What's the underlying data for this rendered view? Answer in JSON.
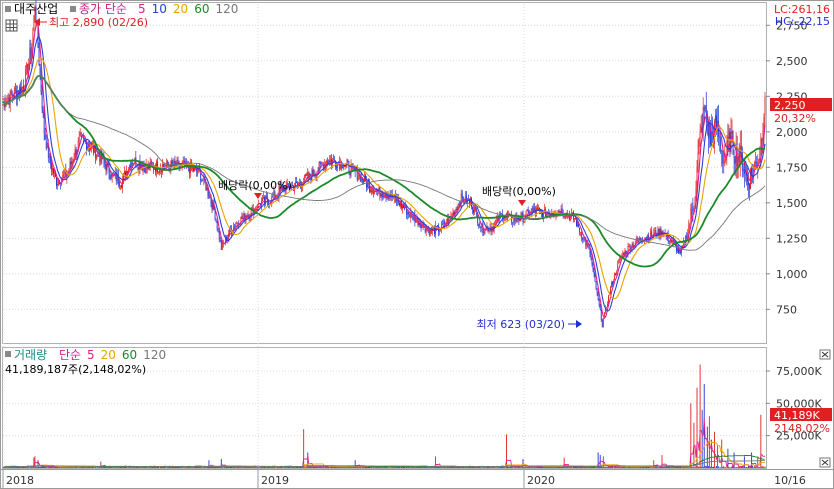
{
  "header": {
    "stock_name": "대주산업",
    "price_legend_label": "종가 단순",
    "ma_periods": [
      "5",
      "10",
      "20",
      "60",
      "120"
    ],
    "ma_colors": [
      "#e0218a",
      "#2a40d8",
      "#e8a400",
      "#1a8a2a",
      "#777777"
    ],
    "lc_text": "LC:261,16",
    "hc_text": "HC:-22,15"
  },
  "volume_header": {
    "label": "거래량",
    "legend_label": "단순",
    "ma_periods": [
      "5",
      "20",
      "60",
      "120"
    ],
    "ma_colors": [
      "#e0218a",
      "#e8a400",
      "#1a8a2a",
      "#777777"
    ],
    "value_text": "41,189,187주(2,148,02%)"
  },
  "annotations": {
    "high": "최고 2,890 (02/26)",
    "low": "최저 623 (03/20)",
    "dividend_1": "배당락(0,00%)",
    "dividend_2": "배당락(0,00%)"
  },
  "current": {
    "price_box": "2,250",
    "price_pct": "20,32%",
    "volume_box": "41,189K",
    "volume_pct": "2148,02%"
  },
  "colors": {
    "up": "#e02020",
    "down": "#2030d0",
    "grid": "#d8d8d8",
    "axis_text": "#333333",
    "current_box": "#e02020"
  },
  "chart_data": {
    "type": "candlestick",
    "price_axis": {
      "ticks": [
        "2,750",
        "2,500",
        "2,250",
        "2,000",
        "1,750",
        "1,500",
        "1,250",
        "1,000",
        "750"
      ],
      "tick_values": [
        2750,
        2500,
        2250,
        2000,
        1750,
        1500,
        1250,
        1000,
        750
      ],
      "ylim": [
        520,
        2900
      ]
    },
    "volume_axis": {
      "ticks": [
        "75,000K",
        "50,000K",
        "25,000K"
      ],
      "tick_values": [
        75000,
        50000,
        25000
      ],
      "ylim": [
        0,
        92000
      ]
    },
    "x_labels": [
      "2018",
      "2019",
      "2020",
      "10/16"
    ],
    "price_keypoints": [
      [
        0,
        2200
      ],
      [
        10,
        2270
      ],
      [
        20,
        2320
      ],
      [
        28,
        2600
      ],
      [
        31,
        2890
      ],
      [
        35,
        2500
      ],
      [
        40,
        2000
      ],
      [
        45,
        1800
      ],
      [
        52,
        1650
      ],
      [
        62,
        1700
      ],
      [
        75,
        1950
      ],
      [
        85,
        1900
      ],
      [
        95,
        1820
      ],
      [
        105,
        1700
      ],
      [
        115,
        1650
      ],
      [
        125,
        1800
      ],
      [
        140,
        1750
      ],
      [
        155,
        1760
      ],
      [
        170,
        1760
      ],
      [
        180,
        1750
      ],
      [
        190,
        1720
      ],
      [
        198,
        1600
      ],
      [
        205,
        1450
      ],
      [
        212,
        1180
      ],
      [
        220,
        1300
      ],
      [
        228,
        1370
      ],
      [
        240,
        1430
      ],
      [
        250,
        1500
      ],
      [
        260,
        1520
      ],
      [
        270,
        1600
      ],
      [
        285,
        1620
      ],
      [
        300,
        1700
      ],
      [
        315,
        1800
      ],
      [
        330,
        1780
      ],
      [
        345,
        1700
      ],
      [
        355,
        1620
      ],
      [
        365,
        1580
      ],
      [
        375,
        1560
      ],
      [
        385,
        1500
      ],
      [
        395,
        1420
      ],
      [
        405,
        1360
      ],
      [
        415,
        1300
      ],
      [
        425,
        1320
      ],
      [
        435,
        1400
      ],
      [
        445,
        1530
      ],
      [
        455,
        1500
      ],
      [
        465,
        1320
      ],
      [
        475,
        1330
      ],
      [
        485,
        1420
      ],
      [
        495,
        1380
      ],
      [
        505,
        1400
      ],
      [
        515,
        1450
      ],
      [
        525,
        1420
      ],
      [
        540,
        1450
      ],
      [
        555,
        1390
      ],
      [
        562,
        1280
      ],
      [
        570,
        1150
      ],
      [
        577,
        850
      ],
      [
        582,
        650
      ],
      [
        590,
        900
      ],
      [
        600,
        1120
      ],
      [
        610,
        1200
      ],
      [
        620,
        1250
      ],
      [
        632,
        1280
      ],
      [
        640,
        1300
      ],
      [
        650,
        1220
      ],
      [
        658,
        1140
      ],
      [
        665,
        1300
      ],
      [
        672,
        1550
      ],
      [
        676,
        1900
      ],
      [
        681,
        2150
      ],
      [
        687,
        1950
      ],
      [
        693,
        2050
      ],
      [
        700,
        1800
      ],
      [
        706,
        1950
      ],
      [
        712,
        1850
      ],
      [
        718,
        1800
      ],
      [
        723,
        1650
      ],
      [
        728,
        1720
      ],
      [
        735,
        1850
      ],
      [
        740,
        2250
      ]
    ],
    "volume_spikes": [
      [
        30,
        8000
      ],
      [
        31,
        9000
      ],
      [
        34,
        6000
      ],
      [
        95,
        5000
      ],
      [
        200,
        6000
      ],
      [
        212,
        7000
      ],
      [
        292,
        30000
      ],
      [
        296,
        12000
      ],
      [
        342,
        6000
      ],
      [
        420,
        9000
      ],
      [
        489,
        26000
      ],
      [
        505,
        7000
      ],
      [
        545,
        8000
      ],
      [
        578,
        12000
      ],
      [
        580,
        10000
      ],
      [
        583,
        9000
      ],
      [
        632,
        6000
      ],
      [
        640,
        10000
      ],
      [
        668,
        50000
      ],
      [
        671,
        35000
      ],
      [
        674,
        62000
      ],
      [
        677,
        80000
      ],
      [
        679,
        45000
      ],
      [
        681,
        65000
      ],
      [
        684,
        32000
      ],
      [
        686,
        40000
      ],
      [
        688,
        22000
      ],
      [
        691,
        28000
      ],
      [
        694,
        18000
      ],
      [
        698,
        22000
      ],
      [
        704,
        15000
      ],
      [
        710,
        12000
      ],
      [
        720,
        9000
      ],
      [
        727,
        12000
      ],
      [
        733,
        8000
      ],
      [
        736,
        41189
      ]
    ]
  }
}
